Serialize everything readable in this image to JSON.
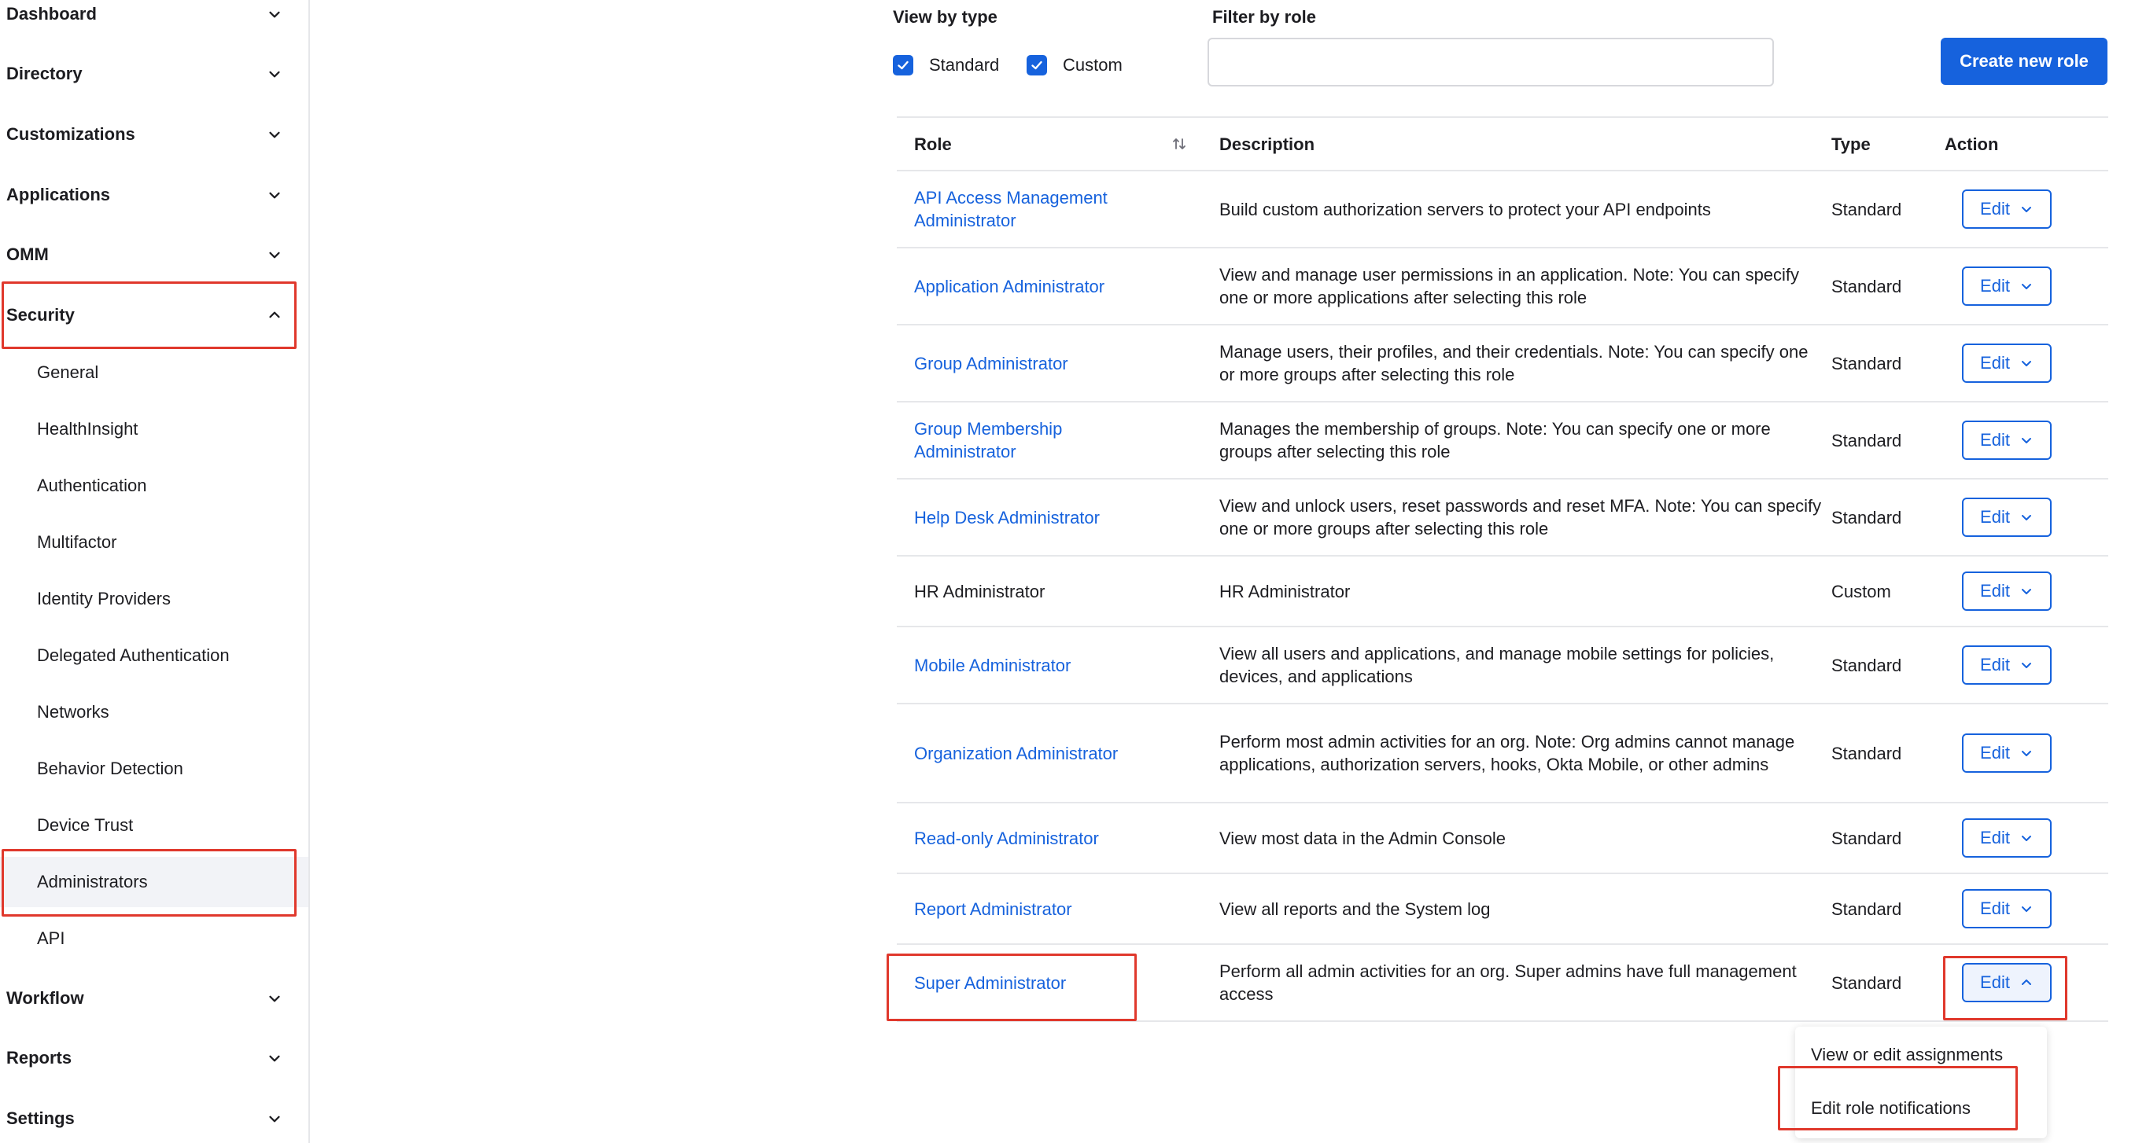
{
  "sidebar": {
    "items": [
      {
        "label": "Dashboard"
      },
      {
        "label": "Directory"
      },
      {
        "label": "Customizations"
      },
      {
        "label": "Applications"
      },
      {
        "label": "OMM"
      },
      {
        "label": "Security"
      },
      {
        "label": "Workflow"
      },
      {
        "label": "Reports"
      },
      {
        "label": "Settings"
      }
    ],
    "security_subitems": [
      {
        "label": "General"
      },
      {
        "label": "HealthInsight"
      },
      {
        "label": "Authentication"
      },
      {
        "label": "Multifactor"
      },
      {
        "label": "Identity Providers"
      },
      {
        "label": "Delegated Authentication"
      },
      {
        "label": "Networks"
      },
      {
        "label": "Behavior Detection"
      },
      {
        "label": "Device Trust"
      },
      {
        "label": "Administrators"
      },
      {
        "label": "API"
      }
    ]
  },
  "filters": {
    "view_by_type_label": "View by type",
    "standard_label": "Standard",
    "custom_label": "Custom",
    "filter_by_role_label": "Filter by role",
    "filter_value": ""
  },
  "create_button_label": "Create new role",
  "table": {
    "headers": {
      "role": "Role",
      "description": "Description",
      "type": "Type",
      "action": "Action"
    },
    "edit_label": "Edit",
    "rows": [
      {
        "role": "API Access Management Administrator",
        "description": "Build custom authorization servers to protect your API endpoints",
        "type": "Standard"
      },
      {
        "role": "Application Administrator",
        "description": "View and manage user permissions in an application. Note: You can specify one or more applications after selecting this role",
        "type": "Standard"
      },
      {
        "role": "Group Administrator",
        "description": "Manage users, their profiles, and their credentials. Note: You can specify one or more groups after selecting this role",
        "type": "Standard"
      },
      {
        "role": "Group Membership Administrator",
        "description": "Manages the membership of groups. Note: You can specify one or more groups after selecting this role",
        "type": "Standard"
      },
      {
        "role": "Help Desk Administrator",
        "description": "View and unlock users, reset passwords and reset MFA. Note: You can specify one or more groups after selecting this role",
        "type": "Standard"
      },
      {
        "role": "HR Administrator",
        "description": "HR Administrator",
        "type": "Custom"
      },
      {
        "role": "Mobile Administrator",
        "description": "View all users and applications, and manage mobile settings for policies, devices, and applications",
        "type": "Standard"
      },
      {
        "role": "Organization Administrator",
        "description": "Perform most admin activities for an org. Note: Org admins cannot manage applications, authorization servers, hooks, Okta Mobile, or other admins",
        "type": "Standard"
      },
      {
        "role": "Read-only Administrator",
        "description": "View most data in the Admin Console",
        "type": "Standard"
      },
      {
        "role": "Report Administrator",
        "description": "View all reports and the System log",
        "type": "Standard"
      },
      {
        "role": "Super Administrator",
        "description": "Perform all admin activities for an org. Super admins have full management access",
        "type": "Standard"
      }
    ]
  },
  "dropdown": {
    "items": [
      {
        "label": "View or edit assignments"
      },
      {
        "label": "Edit role notifications"
      }
    ]
  },
  "icons": {
    "nav_collapsed": "chevron-down-icon",
    "nav_expanded": "chevron-up-icon",
    "sort": "sort-icon",
    "checkbox": "check-icon"
  },
  "colors": {
    "accent": "#1662dd",
    "highlight": "#e0382c",
    "divider": "#e6e7ea",
    "active_bg": "#f2f3f7"
  }
}
